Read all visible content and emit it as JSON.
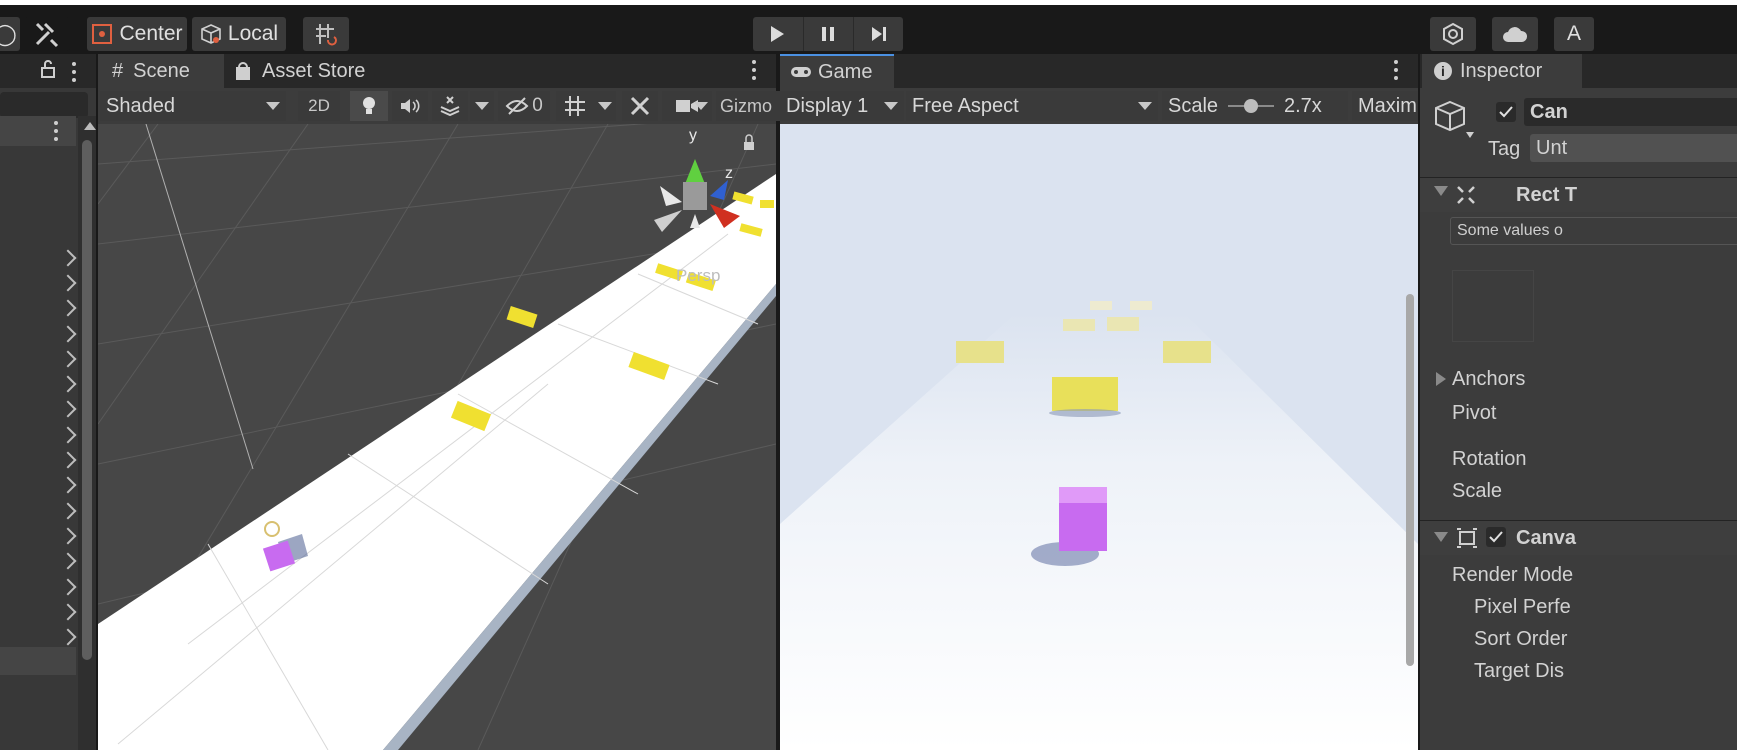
{
  "toolbar": {
    "center_label": "Center",
    "local_label": "Local",
    "right_letter": "A"
  },
  "scene_tab": {
    "tab_label": "Scene",
    "asset_store_label": "Asset Store",
    "shading_mode": "Shaded",
    "mode_2d": "2D",
    "hidden_count": "0",
    "gizmos_label": "Gizmo",
    "persp_label": "Persp",
    "gizmo_axes": {
      "y": "y",
      "z": "z"
    }
  },
  "game_tab": {
    "tab_label": "Game",
    "display": "Display 1",
    "aspect": "Free Aspect",
    "scale_label": "Scale",
    "scale_value": "2.7x",
    "maximize_label": "Maxim"
  },
  "inspector": {
    "tab_label": "Inspector",
    "object_name": "Can",
    "tag_label": "Tag",
    "tag_value": "Unt",
    "rect_transform_label": "Rect T",
    "some_values_label": "Some values o",
    "anchors_label": "Anchors",
    "pivot_label": "Pivot",
    "rotation_label": "Rotation",
    "scale_label": "Scale",
    "canvas_label": "Canva",
    "render_mode_label": "Render Mode",
    "pixel_perfect_label": "Pixel Perfe",
    "sort_order_label": "Sort Order",
    "target_display_label": "Target Dis"
  },
  "colors": {
    "background": "#191919",
    "panel": "#3c3c3c",
    "accent_blue": "#4a90e2",
    "road": "#ffffff",
    "sky": "#dbe3f0",
    "yellow_block": "#f5e642",
    "purple_cube": "#c86bf0"
  }
}
